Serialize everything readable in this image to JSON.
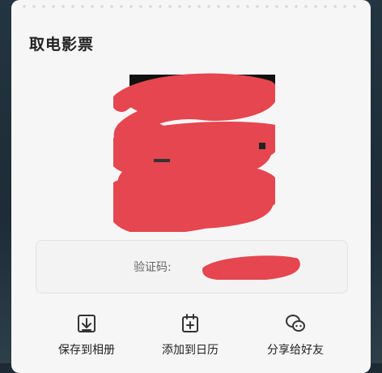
{
  "ticket": {
    "title": "取电影票",
    "verify_label": "验证码:"
  },
  "actions": [
    {
      "label": "保存到相册",
      "icon": "download-icon"
    },
    {
      "label": "添加到日历",
      "icon": "calendar-add-icon"
    },
    {
      "label": "分享给好友",
      "icon": "share-chat-icon"
    }
  ],
  "colors": {
    "redaction": "#e5464f",
    "card": "#f7f6f6",
    "background": "#1e2a33"
  }
}
